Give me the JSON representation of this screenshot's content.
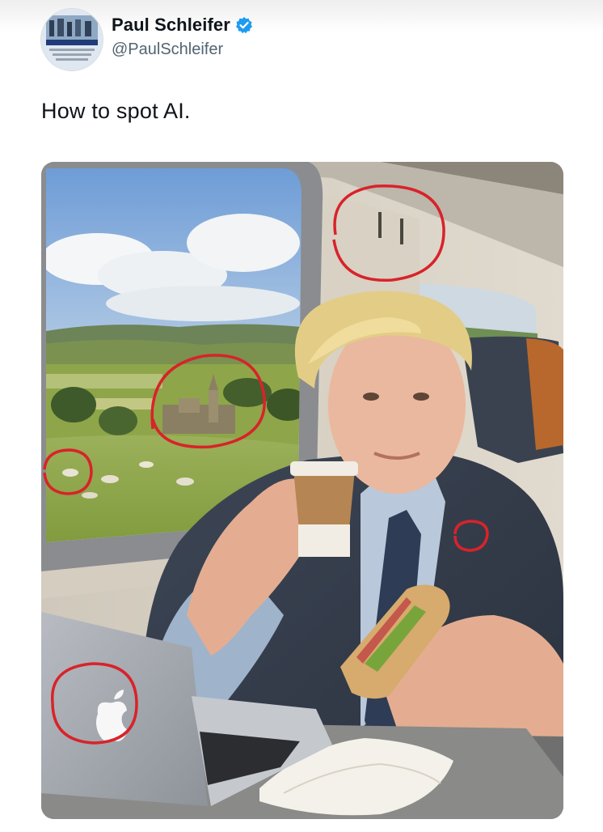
{
  "tweet": {
    "author": {
      "display_name": "Paul Schleifer",
      "handle": "@PaulSchleifer",
      "verified": true,
      "avatar": "avatar-photo"
    },
    "text": "How to spot AI.",
    "media": {
      "type": "photo",
      "annotations": [
        "coat-hooks-circle",
        "village-church-circle",
        "sheep-circle",
        "jacket-spot-circle",
        "laptop-logo-circle"
      ]
    }
  },
  "colors": {
    "verified_blue": "#1d9bf0",
    "annotation_red": "#d8232a",
    "handle_gray": "#536471"
  },
  "icons": [
    "verified-badge-icon",
    "apple-logo-icon"
  ]
}
